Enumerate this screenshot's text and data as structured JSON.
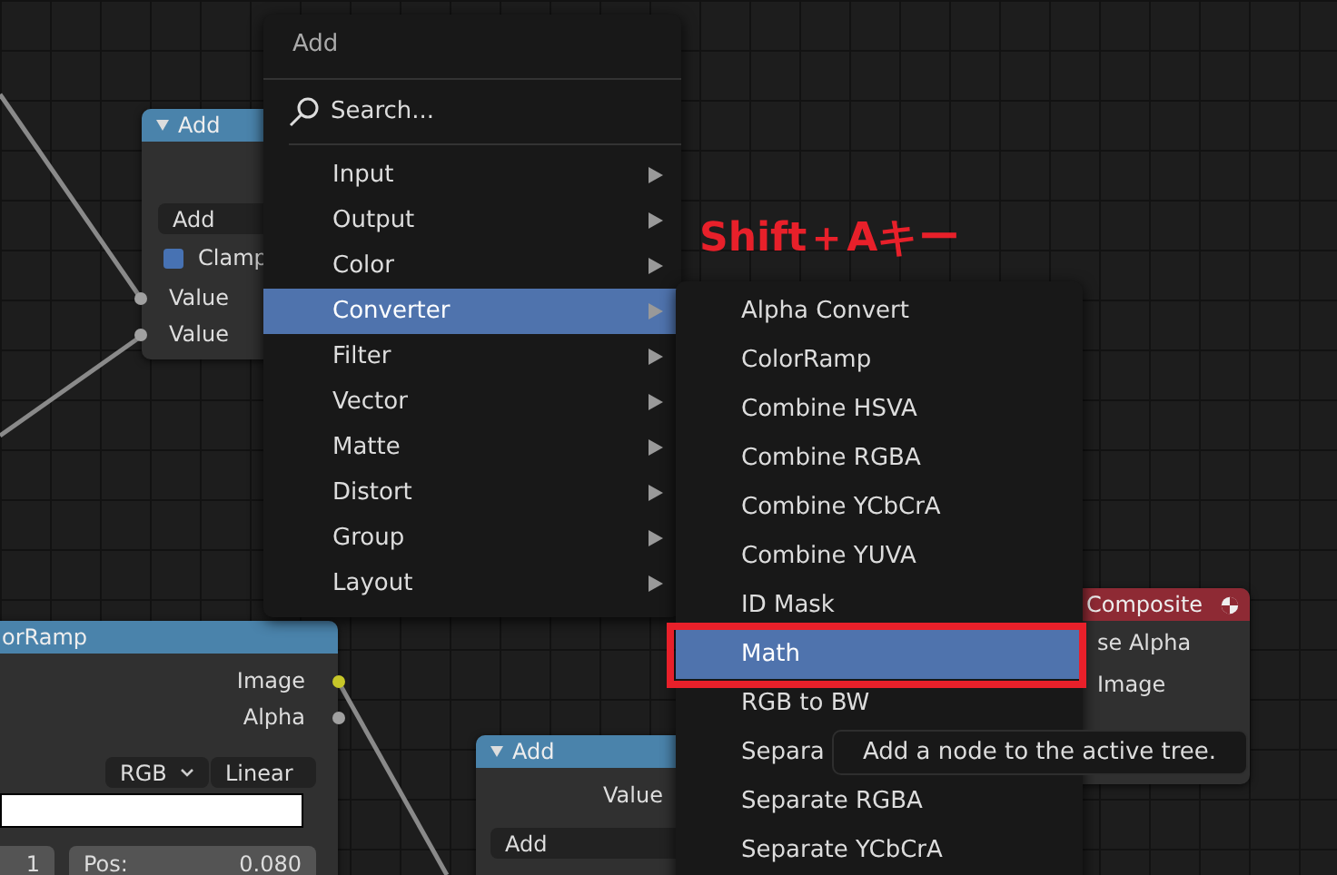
{
  "add_node_top": {
    "title": "Add",
    "operation": "Add",
    "clamp": {
      "label": "Clamp",
      "checked": true
    },
    "inputs": [
      "Value",
      "Value"
    ]
  },
  "colorramp_node": {
    "title": "orRamp",
    "outputs": [
      "Image",
      "Alpha"
    ],
    "color_mode": "RGB",
    "interpolation": "Linear",
    "stop_index": "1",
    "pos_label": "Pos:",
    "pos_value": "0.080"
  },
  "add_node_bottom": {
    "title": "Add",
    "output": "Value",
    "operation": "Add"
  },
  "composite_node": {
    "title": "Composite",
    "use_alpha": "se Alpha",
    "input": "Image"
  },
  "add_menu": {
    "title": "Add",
    "search": {
      "placeholder": "Search..."
    },
    "items": [
      {
        "label": "Input",
        "selected": false
      },
      {
        "label": "Output",
        "selected": false
      },
      {
        "label": "Color",
        "selected": false
      },
      {
        "label": "Converter",
        "selected": true
      },
      {
        "label": "Filter",
        "selected": false
      },
      {
        "label": "Vector",
        "selected": false
      },
      {
        "label": "Matte",
        "selected": false
      },
      {
        "label": "Distort",
        "selected": false
      },
      {
        "label": "Group",
        "selected": false
      },
      {
        "label": "Layout",
        "selected": false
      }
    ]
  },
  "annotation": "Shift＋Aキー",
  "converter_menu": {
    "items": [
      {
        "label": "Alpha Convert",
        "selected": false
      },
      {
        "label": "ColorRamp",
        "selected": false
      },
      {
        "label": "Combine HSVA",
        "selected": false
      },
      {
        "label": "Combine RGBA",
        "selected": false
      },
      {
        "label": "Combine YCbCrA",
        "selected": false
      },
      {
        "label": "Combine YUVA",
        "selected": false
      },
      {
        "label": "ID Mask",
        "selected": false
      },
      {
        "label": "Math",
        "selected": true
      },
      {
        "label": "RGB to BW",
        "selected": false
      },
      {
        "label": "Separa",
        "selected": false
      },
      {
        "label": "Separate RGBA",
        "selected": false
      },
      {
        "label": "Separate YCbCrA",
        "selected": false
      }
    ]
  },
  "tooltip": "Add a node to the active tree."
}
